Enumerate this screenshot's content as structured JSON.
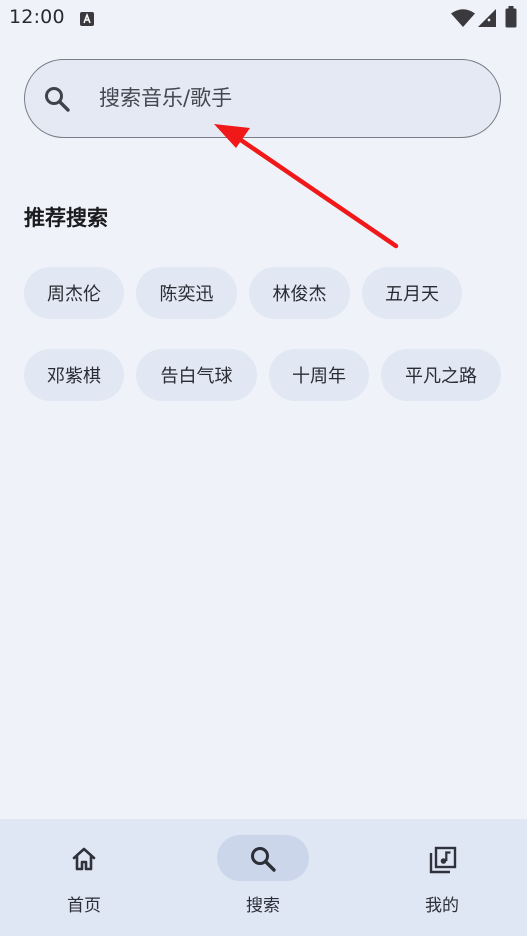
{
  "status_bar": {
    "time": "12:00",
    "app_icon": "a-badge-icon",
    "wifi_icon": "wifi-icon",
    "signal_icon": "cell-signal-icon",
    "battery_icon": "battery-icon"
  },
  "search": {
    "placeholder": "搜索音乐/歌手",
    "value": "",
    "icon": "search-icon"
  },
  "recommend": {
    "title": "推荐搜索",
    "chips": [
      "周杰伦",
      "陈奕迅",
      "林俊杰",
      "五月天",
      "邓紫棋",
      "告白气球",
      "十周年",
      "平凡之路"
    ]
  },
  "bottom_nav": {
    "items": [
      {
        "label": "首页",
        "icon": "home-icon",
        "active": false
      },
      {
        "label": "搜索",
        "icon": "search-icon",
        "active": true
      },
      {
        "label": "我的",
        "icon": "music-library-icon",
        "active": false
      }
    ]
  },
  "colors": {
    "background": "#eff3f9",
    "chip": "#e1e7f3",
    "nav_background": "#dfe7f5",
    "nav_active_pill": "#cbd6ea",
    "annotation_arrow": "#f01818"
  }
}
